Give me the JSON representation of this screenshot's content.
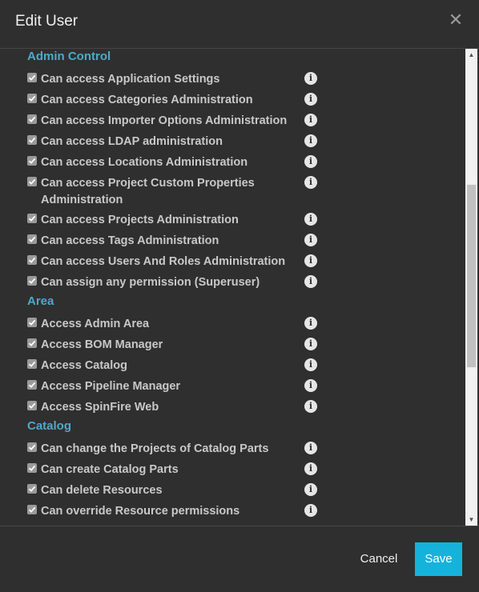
{
  "dialog": {
    "title": "Edit User",
    "close_icon": "close-icon",
    "info_glyph": "i"
  },
  "sections": [
    {
      "title": "Admin Control",
      "items": [
        {
          "label": "Can access Application Settings",
          "checked": true
        },
        {
          "label": "Can access Categories Administration",
          "checked": true
        },
        {
          "label": "Can access Importer Options Administration",
          "checked": true
        },
        {
          "label": "Can access LDAP administration",
          "checked": true
        },
        {
          "label": "Can access Locations Administration",
          "checked": true
        },
        {
          "label": "Can access Project Custom Properties Administration",
          "checked": true
        },
        {
          "label": "Can access Projects Administration",
          "checked": true
        },
        {
          "label": "Can access Tags Administration",
          "checked": true
        },
        {
          "label": "Can access Users And Roles Administration",
          "checked": true
        },
        {
          "label": "Can assign any permission (Superuser)",
          "checked": true
        }
      ]
    },
    {
      "title": "Area",
      "items": [
        {
          "label": "Access Admin Area",
          "checked": true
        },
        {
          "label": "Access BOM Manager",
          "checked": true
        },
        {
          "label": "Access Catalog",
          "checked": true
        },
        {
          "label": "Access Pipeline Manager",
          "checked": true
        },
        {
          "label": "Access SpinFire Web",
          "checked": true
        }
      ]
    },
    {
      "title": "Catalog",
      "items": [
        {
          "label": "Can change the Projects of Catalog Parts",
          "checked": true
        },
        {
          "label": "Can create Catalog Parts",
          "checked": true
        },
        {
          "label": "Can delete Resources",
          "checked": true
        },
        {
          "label": "Can override Resource permissions",
          "checked": true
        }
      ]
    }
  ],
  "footer": {
    "cancel_label": "Cancel",
    "save_label": "Save"
  },
  "colors": {
    "background": "#2f2f2f",
    "section_heading": "#4fa9c9",
    "save_button": "#14b3dc"
  }
}
